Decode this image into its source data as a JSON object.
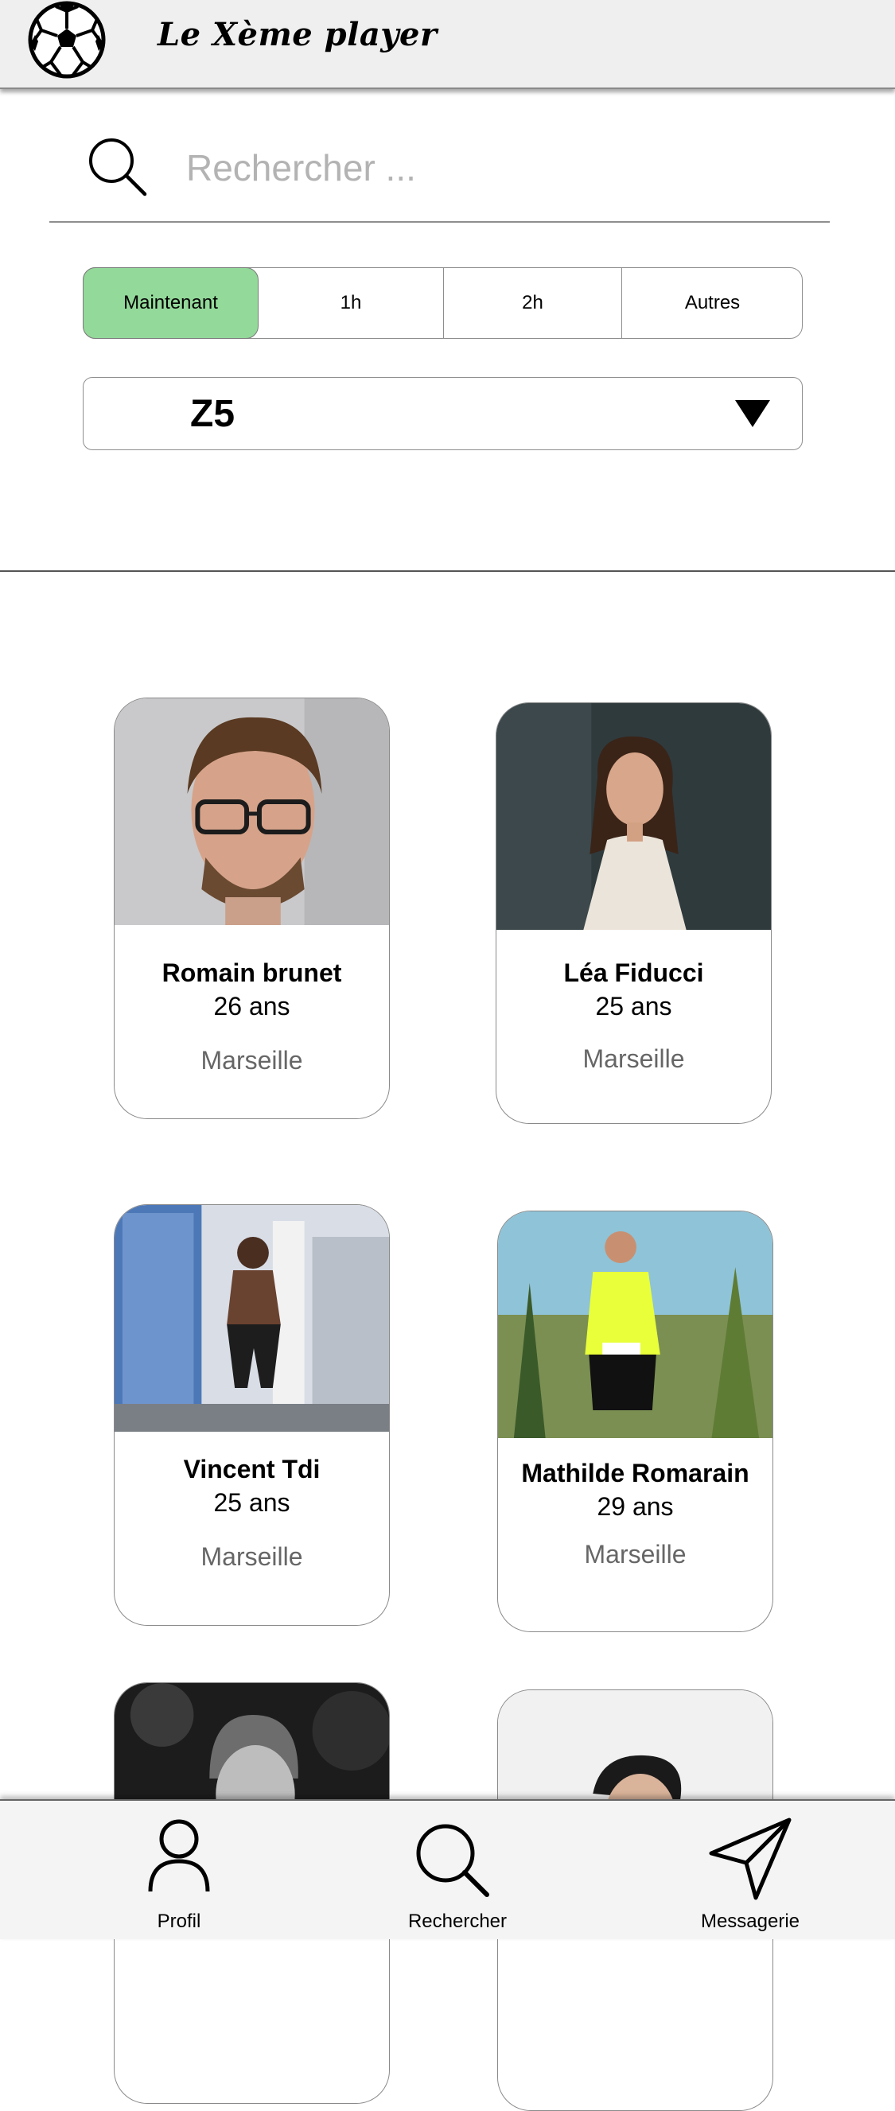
{
  "header": {
    "title": "Le Xème player",
    "logo_icon": "soccer-ball-icon"
  },
  "search": {
    "placeholder": "Rechercher ...",
    "icon": "search-icon"
  },
  "time_filter": {
    "options": [
      "Maintenant",
      "1h",
      "2h",
      "Autres"
    ],
    "selected": "Maintenant",
    "active_color": "#93d99a"
  },
  "zone_select": {
    "value": "Z5",
    "icon": "triangle-down-icon"
  },
  "players": [
    {
      "name": "Romain brunet",
      "age": "26 ans",
      "city": "Marseille"
    },
    {
      "name": "Léa Fiducci",
      "age": "25 ans",
      "city": "Marseille"
    },
    {
      "name": "Vincent Tdi",
      "age": "25 ans",
      "city": "Marseille"
    },
    {
      "name": "Mathilde Romarain",
      "age": "29 ans",
      "city": "Marseille"
    }
  ],
  "bottom_nav": {
    "items": [
      {
        "label": "Profil",
        "icon": "user-icon"
      },
      {
        "label": "Rechercher",
        "icon": "search-icon"
      },
      {
        "label": "Messagerie",
        "icon": "paper-plane-icon"
      }
    ]
  }
}
